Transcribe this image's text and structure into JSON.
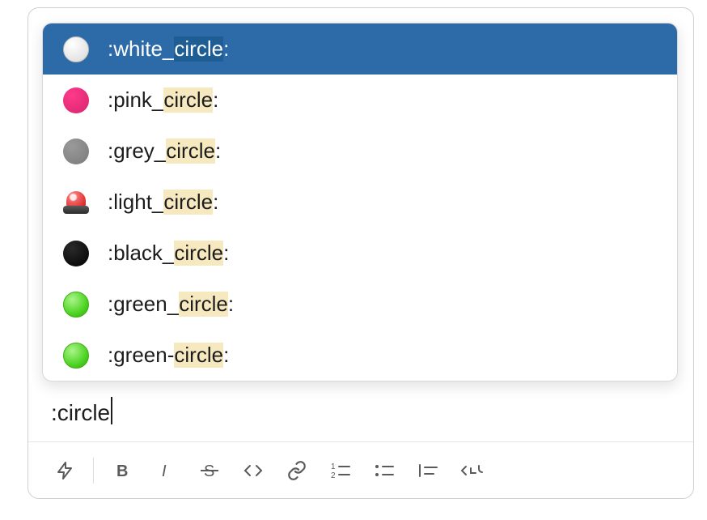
{
  "autocomplete": {
    "query": ":circle",
    "match": "circle",
    "items": [
      {
        "icon": "white-circle-icon",
        "prefix": ":white_",
        "suffix": ":",
        "selected": true
      },
      {
        "icon": "pink-circle-icon",
        "prefix": ":pink_",
        "suffix": ":",
        "selected": false
      },
      {
        "icon": "grey-circle-icon",
        "prefix": ":grey_",
        "suffix": ":",
        "selected": false
      },
      {
        "icon": "siren-icon",
        "prefix": ":light_",
        "suffix": ":",
        "selected": false
      },
      {
        "icon": "black-circle-icon",
        "prefix": ":black_",
        "suffix": ":",
        "selected": false
      },
      {
        "icon": "green-circle-icon",
        "prefix": ":green_",
        "suffix": ":",
        "selected": false
      },
      {
        "icon": "green-circle-icon",
        "prefix": ":green-",
        "suffix": ":",
        "selected": false
      }
    ]
  },
  "input": {
    "value": ":circle"
  },
  "toolbar": {
    "shortcut_label": "",
    "bold_label": "",
    "italic_label": "",
    "strike_label": "",
    "code_label": "",
    "link_label": "",
    "ol_label": "",
    "ul_label": "",
    "quote_label": "",
    "codeblock_label": ""
  }
}
